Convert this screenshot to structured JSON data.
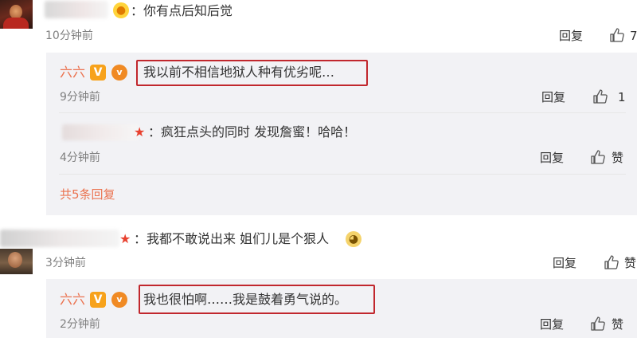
{
  "comments": [
    {
      "text": "：你有点后知后觉",
      "time": "10分钟前",
      "reply_label": "回复",
      "like_count": "7"
    },
    {
      "text": "：我都不敢说出来 姐们儿是个狠人",
      "time": "3分钟前",
      "reply_label": "回复",
      "like_label": "赞"
    }
  ],
  "thread1": {
    "replies": [
      {
        "author": "六六",
        "text": "我以前不相信地狱人种有优劣呢…",
        "time": "9分钟前",
        "reply_label": "回复",
        "like_count": "1"
      },
      {
        "text": "：疯狂点头的同时 发现詹蜜！哈哈！",
        "time": "4分钟前",
        "reply_label": "回复",
        "like_label": "赞"
      }
    ],
    "more_label": "共5条回复"
  },
  "thread2": {
    "replies": [
      {
        "author": "六六",
        "text": "我也很怕啊……我是鼓着勇气说的。",
        "time": "2分钟前",
        "reply_label": "回复",
        "like_label": "赞"
      }
    ]
  },
  "badges": {
    "vip_glyph": "V",
    "verify_glyph": "v"
  },
  "icons": [
    "duck-emoji-icon",
    "vip-badge-icon",
    "verified-badge-icon",
    "thumbs-up-icon",
    "star-icon",
    "doge-emoji-icon"
  ],
  "colors": {
    "username": "#eb7350",
    "highlight_box": "#c1272d",
    "panel_bg": "#f2f2f5",
    "text": "#333333",
    "muted": "#808080"
  }
}
